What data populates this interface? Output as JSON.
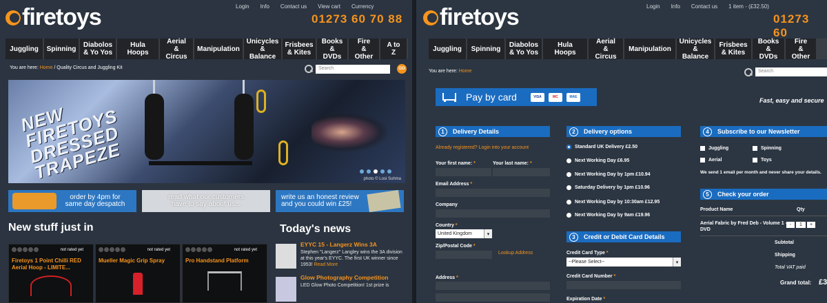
{
  "left": {
    "brand": "firetoys",
    "top_links": [
      "Login",
      "Info",
      "Contact us",
      "View cart",
      "Currency"
    ],
    "phone": "01273 60 70 88",
    "nav": [
      "Juggling",
      "Spinning",
      "Diabolos\n& Yo Yos",
      "Hula Hoops",
      "Aerial\n& Circus",
      "Manipulation",
      "Unicycles\n& Balance",
      "Frisbees\n& Kites",
      "Books\n& DVDs",
      "Fire\n& Other",
      "A to Z"
    ],
    "breadcrumb_prefix": "You are here:",
    "breadcrumb_home": "Home",
    "breadcrumb_current": " / Quality Circus and Juggling Kit",
    "search_placeholder": "Search",
    "search_go": "GO",
    "hero_text": "NEW\nFIRETOYS\nDRESSED\nTRAPEZE",
    "hero_credit": "photo © Losi Suhma",
    "promos": [
      "order by 4pm for\nsame day despatch",
      "read what our customers\nhave to say about us...",
      "write us an honest review\nand you could win £25!"
    ],
    "new_stuff_title": "New stuff just in",
    "products": [
      {
        "rated": "not rated yet",
        "name": "Firetoys 1 Point Chilli RED Aerial Hoop - LIMITE..."
      },
      {
        "rated": "not rated yet",
        "name": "Mueller Magic Grip Spray"
      },
      {
        "rated": "not rated yet",
        "name": "Pro Handstand Platform"
      }
    ],
    "news_title": "Today's news",
    "news": [
      {
        "title": "EYYC 15 - Langerz Wins 3A",
        "body": "Stephen \"Langerz\" Langley wins the 3A division at this year's EYYC. The first UK winner since 1953!",
        "more": "Read More"
      },
      {
        "title": "Glow Photography Competition",
        "body": "LED Glow Photo Competition! 1st prize is",
        "more": ""
      }
    ]
  },
  "right": {
    "brand": "firetoys",
    "top_links": [
      "Login",
      "Info",
      "Contact us",
      "1 item - (£32.50)"
    ],
    "phone": "01273 60",
    "nav": [
      "Juggling",
      "Spinning",
      "Diabolos\n& Yo Yos",
      "Hula Hoops",
      "Aerial\n& Circus",
      "Manipulation",
      "Unicycles\n& Balance",
      "Frisbees\n& Kites",
      "Books\n& DVDs",
      "Fire\n& Other"
    ],
    "breadcrumb_prefix": "You are here:",
    "breadcrumb_home": "Home",
    "search_placeholder": "Search",
    "pay_title": "Pay by card",
    "cards": [
      "VISA",
      "MC",
      "MAE"
    ],
    "tagline": "Fast, easy and secure",
    "delivery": {
      "num": "1",
      "title": "Delivery Details",
      "registered": "Already registered? Login into your account",
      "first_name": "Your first name:",
      "last_name": "Your last name:",
      "email": "Email Address",
      "company": "Company",
      "country": "Country",
      "country_value": "United Kingdom",
      "postcode": "Zip/Postal Code",
      "lookup": "Lookup Address",
      "address": "Address",
      "req": "*"
    },
    "options": {
      "num": "2",
      "title": "Delivery options",
      "items": [
        "Standard UK Delivery £2.50",
        "Next Working Day £6.95",
        "Next Working Day by 1pm £10.94",
        "Saturday Delivery by 1pm £10.96",
        "Next Working Day by 10:30am £12.95",
        "Next Working Day by 9am £19.96"
      ]
    },
    "card": {
      "num": "3",
      "title": "Credit or Debit Card Details",
      "type_label": "Credit Card Type",
      "type_value": "--Please Select--",
      "number_label": "Credit Card Number",
      "expiry_label": "Expiration Date",
      "req": "*"
    },
    "newsletter": {
      "num": "4",
      "title": "Subscribe to our Newsletter",
      "options": [
        "Juggling",
        "Spinning",
        "Aerial",
        "Toys"
      ],
      "note": "We send 1 email per month and never share your details."
    },
    "order": {
      "num": "5",
      "title": "Check your order",
      "col_product": "Product Name",
      "col_qty": "Qty",
      "item_name": "Aerial Fabric by Fred Deb - Volume 1 - DVD",
      "qty": "1",
      "minus": "-",
      "plus": "+",
      "subtotal": "Subtotal",
      "shipping": "Shipping",
      "vat": "Total VAT paid",
      "grand": "Grand total:",
      "grand_value": "£3"
    }
  }
}
